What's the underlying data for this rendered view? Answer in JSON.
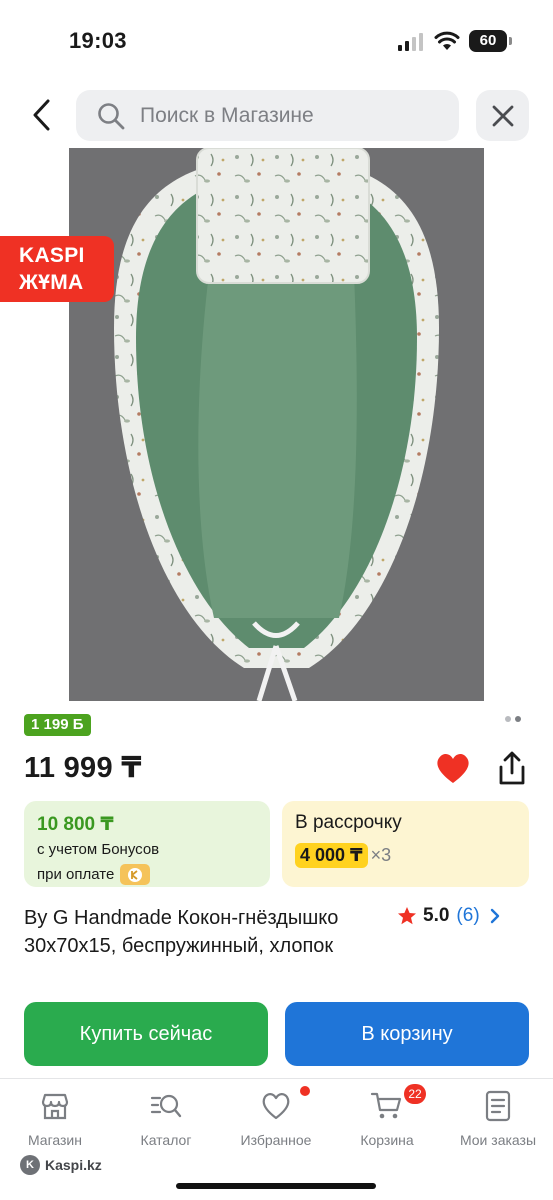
{
  "status_bar": {
    "time": "19:03",
    "battery": "60"
  },
  "header": {
    "search_placeholder": "Поиск в Магазине"
  },
  "product": {
    "promo_badge_line1": "KASPI",
    "promo_badge_line2": "ЖҰМА",
    "bonus_chip": "1 199 Б",
    "price": "11 999 ₸",
    "title": "By G Handmade Кокон-гнёздышко 30x70x15, беспружинный, хлопок",
    "rating_score": "5.0",
    "rating_count": "(6)",
    "gallery_pages": 2,
    "gallery_active": 1
  },
  "bonus_card": {
    "amount": "10 800 ₸",
    "line1": "с учетом Бонусов",
    "line2": "при оплате"
  },
  "installment_card": {
    "label": "В рассрочку",
    "amount": "4 000 ₸",
    "multiplier": "×3"
  },
  "actions": {
    "buy_now": "Купить сейчас",
    "add_to_cart": "В корзину"
  },
  "tabbar": {
    "items": [
      {
        "label": "Магазин",
        "icon": "store-icon"
      },
      {
        "label": "Каталог",
        "icon": "catalog-search-icon"
      },
      {
        "label": "Избранное",
        "icon": "heart-icon"
      },
      {
        "label": "Корзина",
        "icon": "cart-icon"
      },
      {
        "label": "Мои заказы",
        "icon": "orders-icon"
      }
    ],
    "cart_count": "22"
  },
  "brand": "Kaspi.kz",
  "colors": {
    "accent_red": "#ef3124",
    "buy_green": "#2aab4e",
    "cart_blue": "#1f75d8",
    "bonus_green": "#4ca31f",
    "installment_yellow": "#ffd21f"
  }
}
